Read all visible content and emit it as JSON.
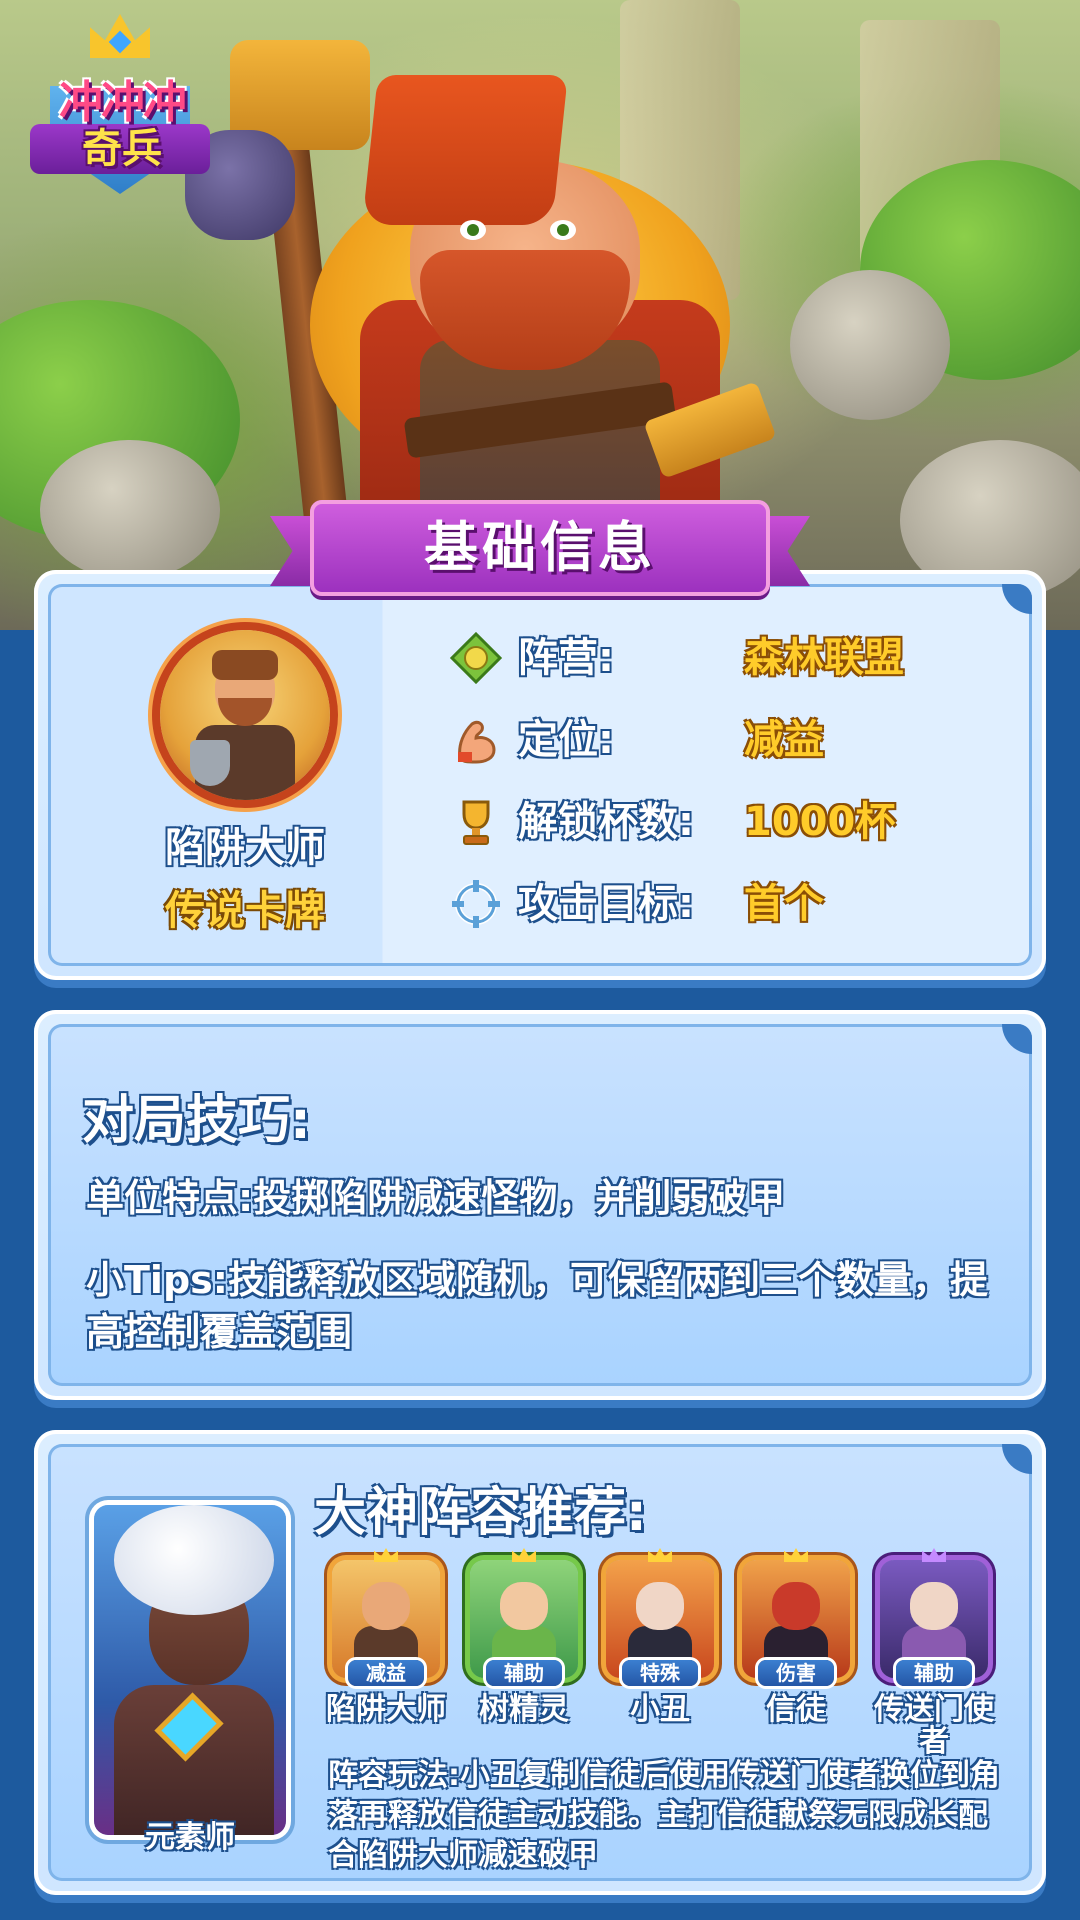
{
  "logo": {
    "line1": "冲冲冲",
    "line2": "奇兵"
  },
  "basic_info": {
    "banner": "基础信息",
    "card_name": "陷阱大师",
    "card_rarity": "传说卡牌",
    "rows": [
      {
        "icon": "faction-icon",
        "label": "阵营:",
        "value": "森林联盟"
      },
      {
        "icon": "muscle-icon",
        "label": "定位:",
        "value": "减益"
      },
      {
        "icon": "trophy-icon",
        "label": "解锁杯数:",
        "value": "1000杯"
      },
      {
        "icon": "target-icon",
        "label": "攻击目标:",
        "value": "首个"
      }
    ]
  },
  "tips": {
    "title": "对局技巧:",
    "feature": "单位特点:投掷陷阱减速怪物，并削弱破甲",
    "tip": "小Tips:技能释放区域随机，可保留两到三个数量，提高控制覆盖范围"
  },
  "lineup": {
    "title": "大神阵容推荐:",
    "featured_name": "元素师",
    "units": [
      {
        "name": "陷阱大师",
        "tag": "减益"
      },
      {
        "name": "树精灵",
        "tag": "辅助"
      },
      {
        "name": "小丑",
        "tag": "特殊"
      },
      {
        "name": "信徒",
        "tag": "伤害"
      },
      {
        "name": "传送门使者",
        "tag": "辅助"
      }
    ],
    "play": "阵容玩法:小丑复制信徒后使用传送门使者换位到角落再释放信徒主动技能。主打信徒献祭无限成长配合陷阱大师减速破甲"
  }
}
